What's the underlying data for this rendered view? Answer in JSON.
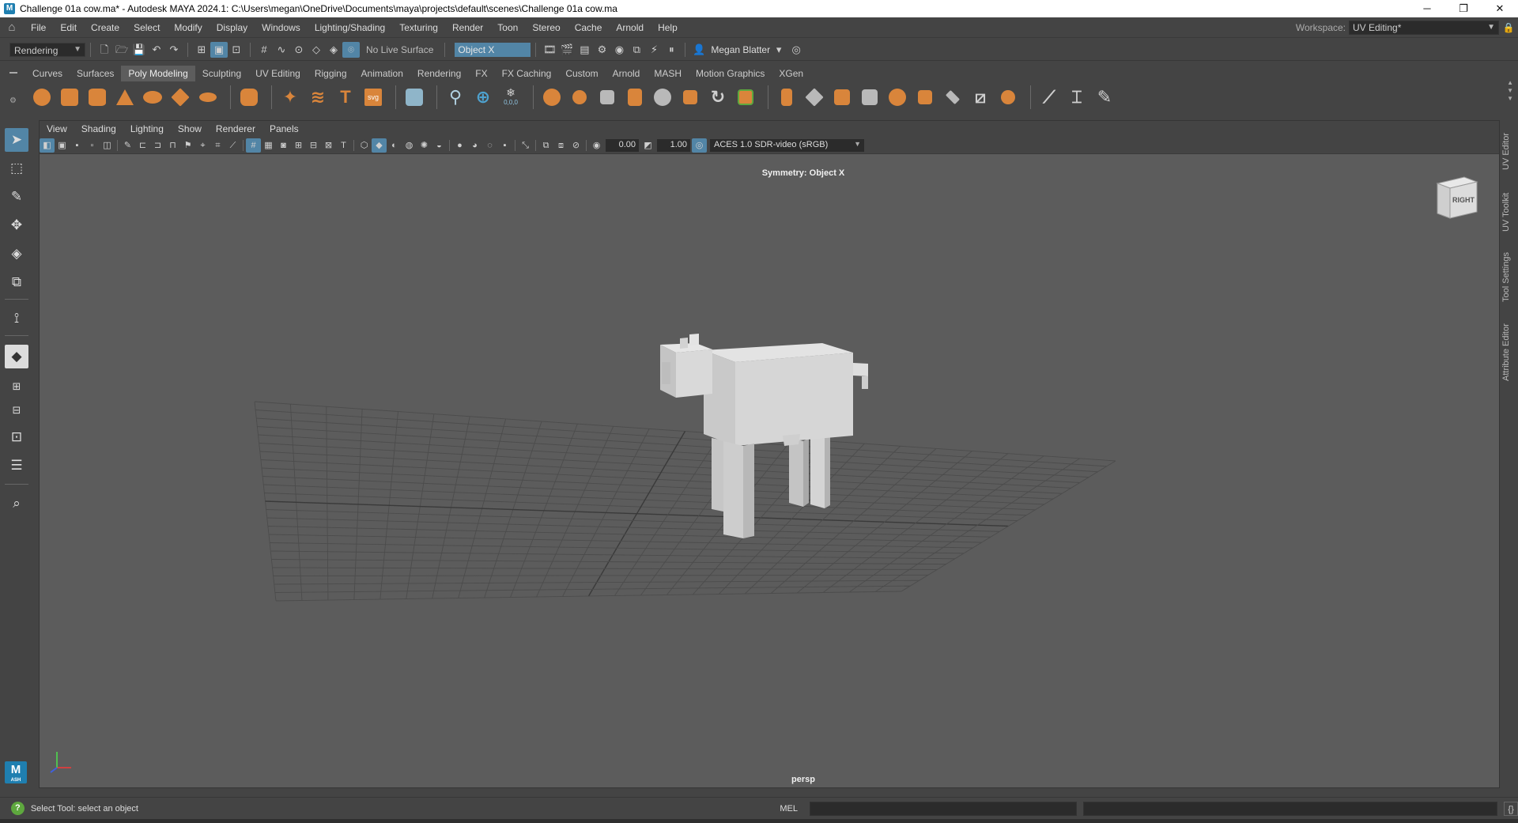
{
  "window": {
    "title": "Challenge 01a cow.ma* - Autodesk MAYA 2024.1: C:\\Users\\megan\\OneDrive\\Documents\\maya\\projects\\default\\scenes\\Challenge 01a cow.ma",
    "app_icon_letter": "M",
    "minimize": "─",
    "restore": "❐",
    "close": "✕"
  },
  "menubar": {
    "items": [
      "File",
      "Edit",
      "Create",
      "Select",
      "Modify",
      "Display",
      "Windows",
      "Lighting/Shading",
      "Texturing",
      "Render",
      "Toon",
      "Stereo",
      "Cache",
      "Arnold",
      "Help"
    ],
    "workspace_label": "Workspace:",
    "workspace_value": "UV Editing*"
  },
  "statusline": {
    "menu_set": "Rendering",
    "live_surface": "No Live Surface",
    "symmetry": "Object X",
    "user": "Megan Blatter"
  },
  "shelf": {
    "tabs": [
      "Curves",
      "Surfaces",
      "Poly Modeling",
      "Sculpting",
      "UV Editing",
      "Rigging",
      "Animation",
      "Rendering",
      "FX",
      "FX Caching",
      "Custom",
      "Arnold",
      "MASH",
      "Motion Graphics",
      "XGen"
    ],
    "active_tab": "Poly Modeling",
    "svg_label": "svg",
    "text_label": "T",
    "coord_label": "0,0,0"
  },
  "viewport": {
    "menus": [
      "View",
      "Shading",
      "Lighting",
      "Show",
      "Renderer",
      "Panels"
    ],
    "exposure": "0.00",
    "gamma": "1.00",
    "color_space": "ACES 1.0 SDR-video (sRGB)",
    "symmetry_label": "Symmetry: Object X",
    "camera": "persp",
    "viewcube_face": "RIGHT"
  },
  "right_tabs": [
    "UV Editor",
    "UV Toolkit",
    "Tool Settings",
    "Attribute Editor"
  ],
  "helpline": {
    "help_text": "Select Tool: select an object",
    "mel_label": "MEL"
  },
  "colors": {
    "accent": "#5285a6",
    "shelf_icon": "#d9853b",
    "viewport_bg": "#5c5c5c",
    "ui_bg": "#444444"
  }
}
